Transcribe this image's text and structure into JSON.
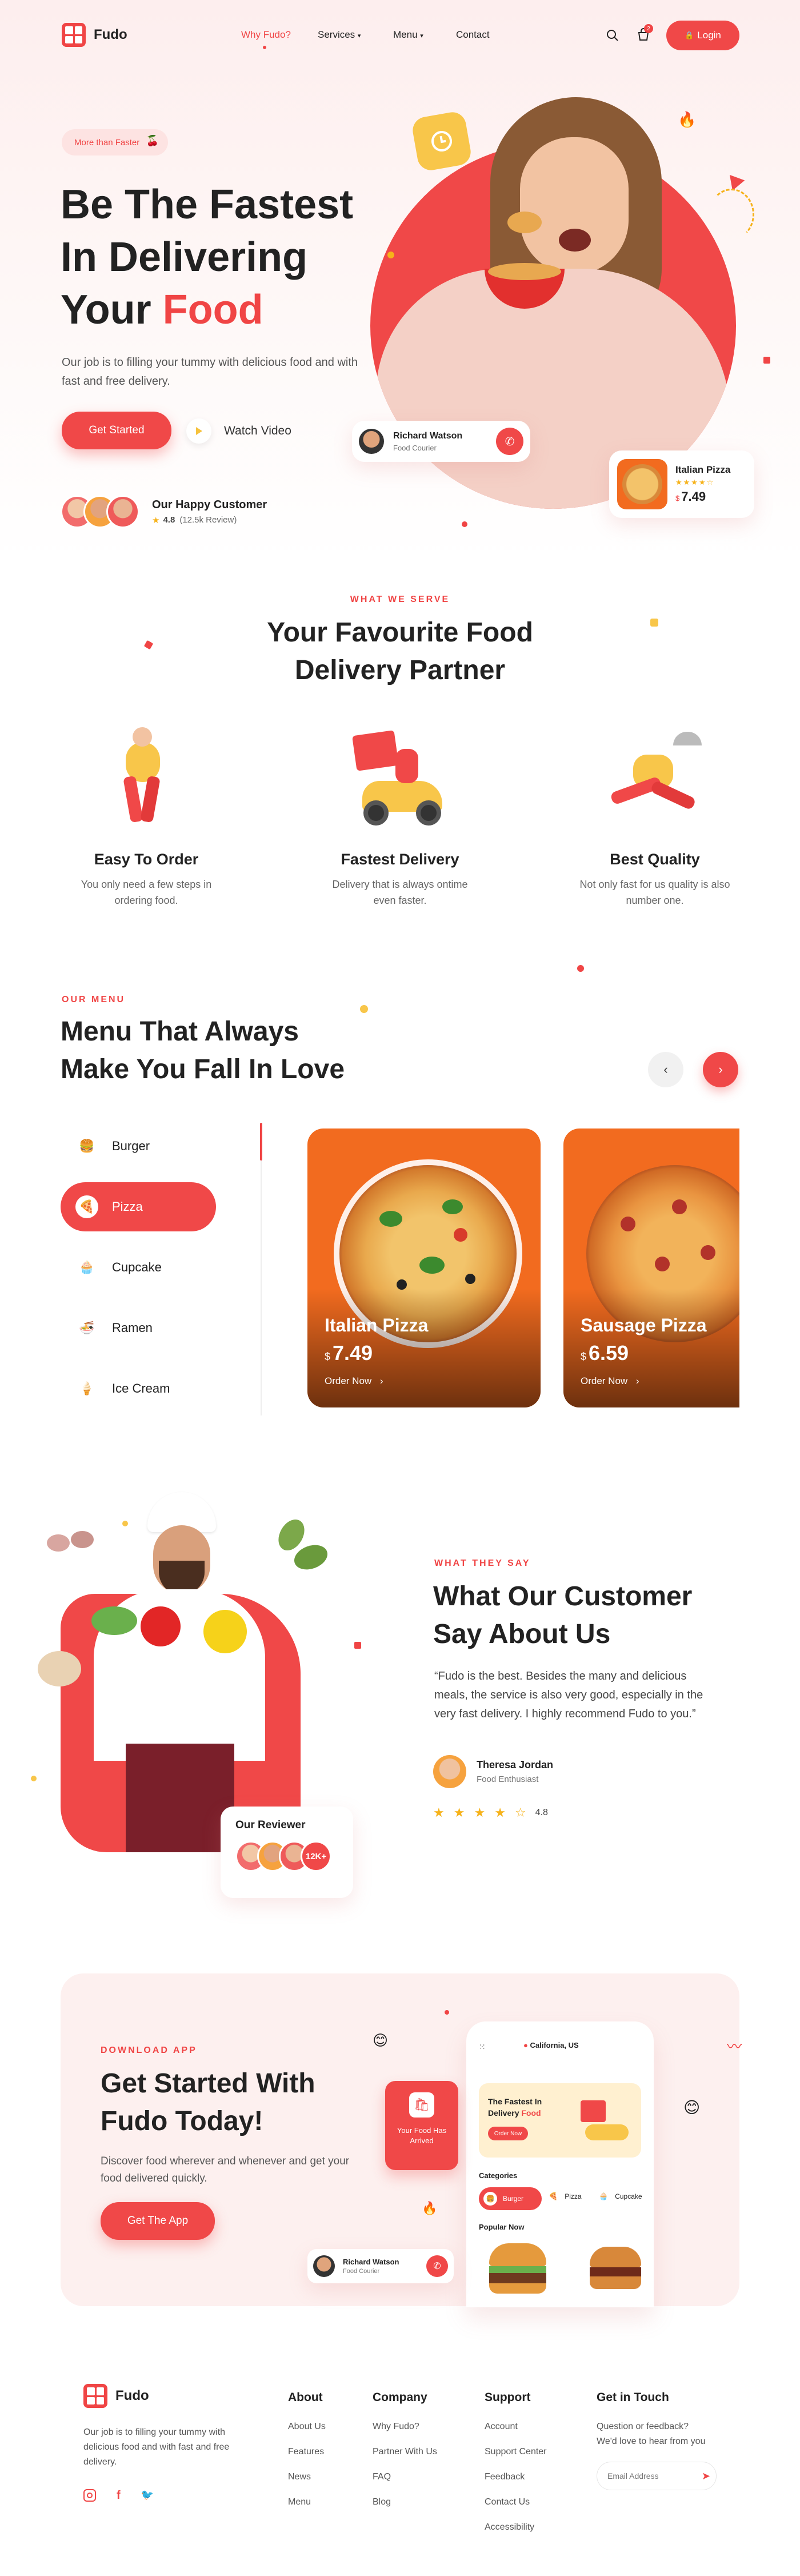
{
  "brand": {
    "name": "Fudo",
    "accent": "#f04545"
  },
  "nav": {
    "items": [
      {
        "label": "Why Fudo?",
        "active": true
      },
      {
        "label": "Services",
        "caret": true
      },
      {
        "label": "Menu",
        "caret": true
      },
      {
        "label": "Contact"
      }
    ],
    "cart_count": "2",
    "login_label": "Login",
    "login_icon": "lock-icon"
  },
  "hero": {
    "badge": "More than Faster",
    "title_line1": "Be The Fastest",
    "title_line2": "In Delivering",
    "title_line3_prefix": "Your ",
    "title_line3_accent": "Food",
    "description": "Our job is to filling your tummy with delicious food and with fast and free delivery.",
    "cta": "Get Started",
    "watch": "Watch Video",
    "customers_title": "Our Happy Customer",
    "rating": "4.8",
    "reviews": "(12.5k Review)",
    "courier_name": "Richard Watson",
    "courier_role": "Food Courier",
    "pizza_card_name": "Italian Pizza",
    "pizza_card_price": "7.49",
    "currency": "$"
  },
  "features": {
    "label": "WHAT WE SERVE",
    "title_line1": "Your Favourite Food",
    "title_line2": "Delivery Partner",
    "items": [
      {
        "title": "Easy To Order",
        "desc_line1": "You only need a few steps in",
        "desc_line2": "ordering food."
      },
      {
        "title": "Fastest Delivery",
        "desc_line1": "Delivery that is always ontime",
        "desc_line2": "even faster."
      },
      {
        "title": "Best Quality",
        "desc_line1": "Not only fast for us quality is also",
        "desc_line2": "number one."
      }
    ]
  },
  "menu": {
    "label": "OUR MENU",
    "title_line1": "Menu That Always",
    "title_line2": "Make You Fall In Love",
    "categories": [
      {
        "label": "Burger",
        "icon": "burger-icon"
      },
      {
        "label": "Pizza",
        "icon": "pizza-icon",
        "active": true
      },
      {
        "label": "Cupcake",
        "icon": "cupcake-icon"
      },
      {
        "label": "Ramen",
        "icon": "ramen-icon"
      },
      {
        "label": "Ice Cream",
        "icon": "ice-cream-icon"
      }
    ],
    "cards": [
      {
        "name": "Italian Pizza",
        "price": "7.49",
        "order": "Order Now"
      },
      {
        "name": "Sausage Pizza",
        "price": "6.59",
        "order": "Order Now"
      }
    ]
  },
  "testimonial": {
    "label": "WHAT THEY SAY",
    "title_line1": "What Our Customer",
    "title_line2": "Say About Us",
    "quote": "“Fudo is the best. Besides the many and delicious meals, the service is also very good, especially in the very fast delivery. I highly recommend Fudo to you.”",
    "author": "Theresa Jordan",
    "author_role": "Food Enthusiast",
    "rating": "4.8",
    "reviewer_title": "Our Reviewer",
    "reviewer_count": "12K+"
  },
  "app": {
    "label": "DOWNLOAD APP",
    "title_line1": "Get Started With",
    "title_line2": "Fudo Today!",
    "description": "Discover food wherever and whenever and get your food delivered quickly.",
    "cta": "Get The App",
    "phone_location": "California, US",
    "phone_banner_line1": "The Fastest In",
    "phone_banner_line2_prefix": "Delivery ",
    "phone_banner_line2_accent": "Food",
    "phone_banner_btn": "Order Now",
    "phone_categories_label": "Categories",
    "phone_categories": [
      "Burger",
      "Pizza",
      "Cupcake"
    ],
    "phone_popular": "Popular Now",
    "notif_line1": "Your Food Has",
    "notif_line2": "Arrived",
    "courier_name": "Richard Watson",
    "courier_role": "Food Courier"
  },
  "footer": {
    "brand_desc": "Our job is to filling your tummy with delicious food and with fast and free delivery.",
    "columns": [
      {
        "title": "About",
        "links": [
          "About Us",
          "Features",
          "News",
          "Menu"
        ]
      },
      {
        "title": "Company",
        "links": [
          "Why Fudo?",
          "Partner With Us",
          "FAQ",
          "Blog"
        ]
      },
      {
        "title": "Support",
        "links": [
          "Account",
          "Support Center",
          "Feedback",
          "Contact Us",
          "Accessibility"
        ]
      }
    ],
    "contact_title": "Get in Touch",
    "contact_desc_line1": "Question or feedback?",
    "contact_desc_line2": "We'd love to hear from you",
    "email_placeholder": "Email Address",
    "socials": [
      "instagram-icon",
      "facebook-icon",
      "twitter-icon"
    ]
  }
}
